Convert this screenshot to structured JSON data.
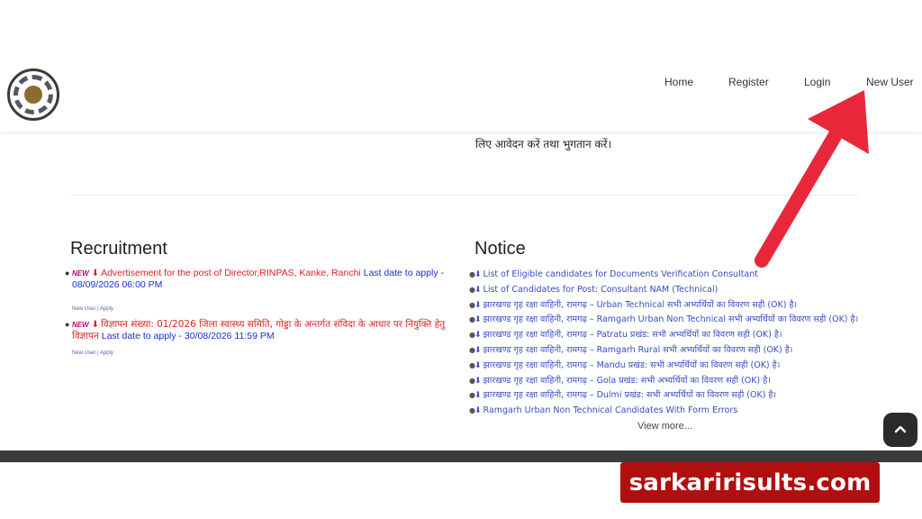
{
  "nav": {
    "home": "Home",
    "register": "Register",
    "login": "Login",
    "new_user": "New User"
  },
  "intro_text": "लिए आवेदन करें तथा भुगतान करें।",
  "recruitment": {
    "title": "Recruitment",
    "badge": "NEW",
    "items": [
      {
        "title": "Advertisement for the post of Director,RINPAS, Kanke, Ranchi",
        "date": "Last date to apply - 08/09/2026 06:00 PM",
        "links": "New User | Apply"
      },
      {
        "title": "विज्ञापन संख्या: 01/2026 जिला स्वास्थ्य समिति, गोड्डा के अन्तर्गत संविदा के आधार पर नियुक्ति हेतु विज्ञापन",
        "date": "Last date to apply - 30/08/2026 11:59 PM",
        "links": "New User | Apply"
      }
    ]
  },
  "notice": {
    "title": "Notice",
    "items": [
      "List of Eligible candidates for Documents Verification Consultant",
      "List of Candidates for Post: Consultant NAM (Technical)",
      "झारखण्ड गृह रक्षा वाहिनी, रामगढ़ – Urban Technical सभी अभ्यर्थियों का विवरण सही (OK) है।",
      "झारखण्ड गृह रक्षा वाहिनी, रामगढ़ – Ramgarh Urban Non Technical सभी अभ्यर्थियों का विवरण सही (OK) है।",
      "झारखण्ड गृह रक्षा वाहिनी, रामगढ़ – Patratu प्रखंड: सभी अभ्यर्थियों का विवरण सही (OK) है।",
      "झारखण्ड गृह रक्षा वाहिनी, रामगढ़ – Ramgarh Rural सभी अभ्यर्थियों का विवरण सही (OK) है।",
      "झारखण्ड गृह रक्षा वाहिनी, रामगढ़ – Mandu प्रखंड: सभी अभ्यर्थियों का विवरण सही (OK) है।",
      "झारखण्ड गृह रक्षा वाहिनी, रामगढ़ – Gola प्रखंड: सभी अभ्यर्थियों का विवरण सही (OK) है।",
      "झारखण्ड गृह रक्षा वाहिनी, रामगढ़ – Dulmi प्रखंड: सभी अभ्यर्थियों का विवरण सही (OK) है।",
      "Ramgarh Urban Non Technical Candidates With Form Errors"
    ],
    "view_more": "View more..."
  },
  "watermark": "sarkaririsults.com",
  "colors": {
    "recruit_title": "#e02020",
    "recruit_date": "#1a2fd0",
    "notice_link": "#3a4ac0",
    "arrow": "#e8283a",
    "watermark_bg": "#b10f0f"
  },
  "icons": [
    "logo-emblem",
    "download-icon",
    "chevron-up-icon",
    "arrow-annotation"
  ]
}
